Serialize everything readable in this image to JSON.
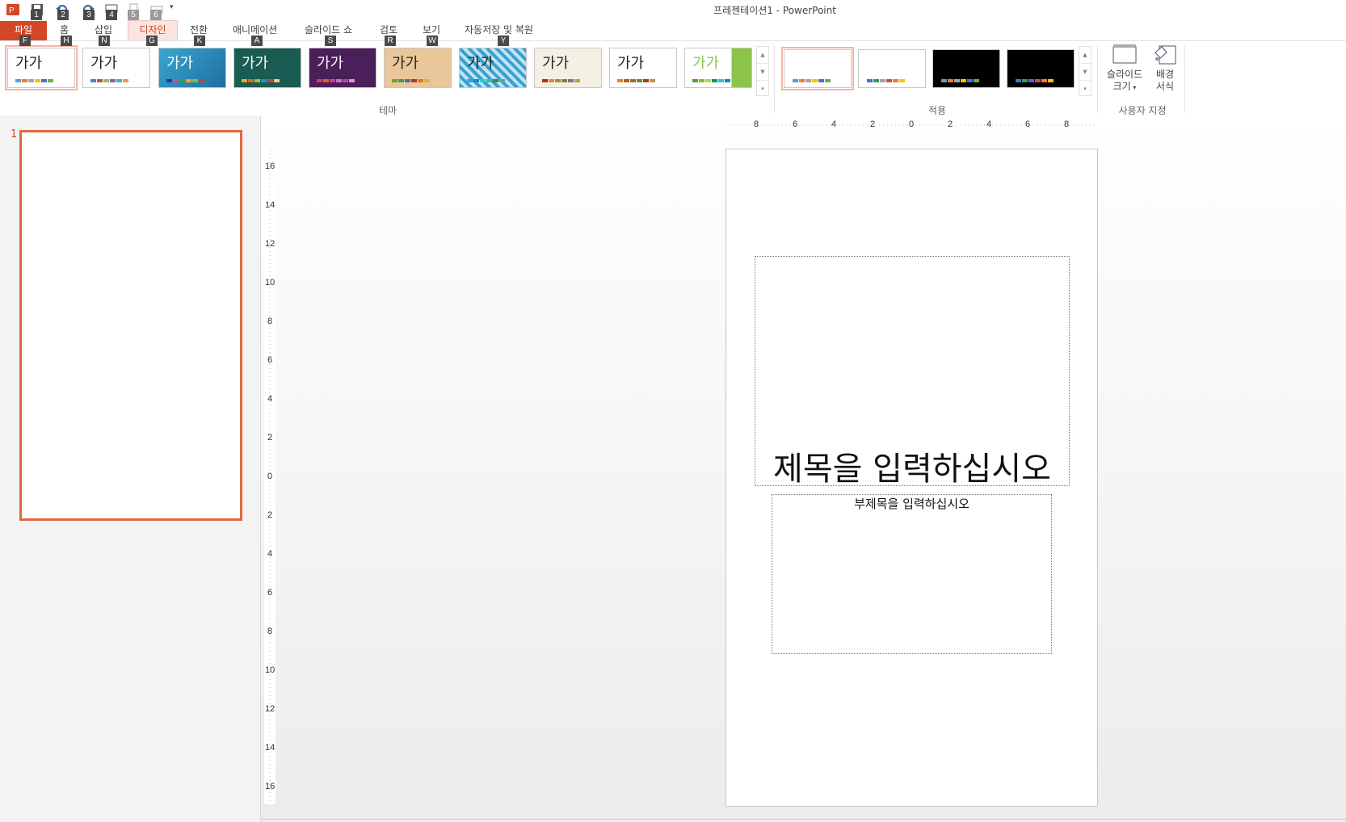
{
  "app": {
    "title": "프레젠테이션1 - PowerPoint"
  },
  "qat": {
    "keytips": [
      "1",
      "2",
      "3",
      "4",
      "5",
      "6"
    ]
  },
  "tabs": [
    {
      "label": "파일",
      "keytip": "F"
    },
    {
      "label": "홈",
      "keytip": "H"
    },
    {
      "label": "삽입",
      "keytip": "N"
    },
    {
      "label": "디자인",
      "keytip": "G"
    },
    {
      "label": "전환",
      "keytip": "K"
    },
    {
      "label": "애니메이션",
      "keytip": "A"
    },
    {
      "label": "슬라이드 쇼",
      "keytip": "S"
    },
    {
      "label": "검토",
      "keytip": "R"
    },
    {
      "label": "보기",
      "keytip": "W"
    },
    {
      "label": "자동저장 및 복원",
      "keytip": "Y"
    }
  ],
  "ribbon": {
    "theme_sample": "가가",
    "themes_group_label": "테마",
    "variants_group_label": "적용",
    "customize_group_label": "사용자 지정",
    "slide_size_line1": "슬라이드",
    "slide_size_line2": "크기",
    "format_bg_line1": "배경",
    "format_bg_line2": "서식"
  },
  "thumbnails": {
    "slide_number": "1"
  },
  "slide": {
    "title_placeholder": "제목을 입력하십시오",
    "subtitle_placeholder": "부제목을 입력하십시오"
  },
  "rulers": {
    "horizontal": [
      "8",
      "6",
      "4",
      "2",
      "0",
      "2",
      "4",
      "6",
      "8"
    ],
    "vertical": [
      "16",
      "14",
      "12",
      "10",
      "8",
      "6",
      "4",
      "2",
      "0",
      "2",
      "4",
      "6",
      "8",
      "10",
      "12",
      "14",
      "16"
    ]
  },
  "colors": {
    "accent": "#d24726",
    "selection": "#e0693f"
  }
}
